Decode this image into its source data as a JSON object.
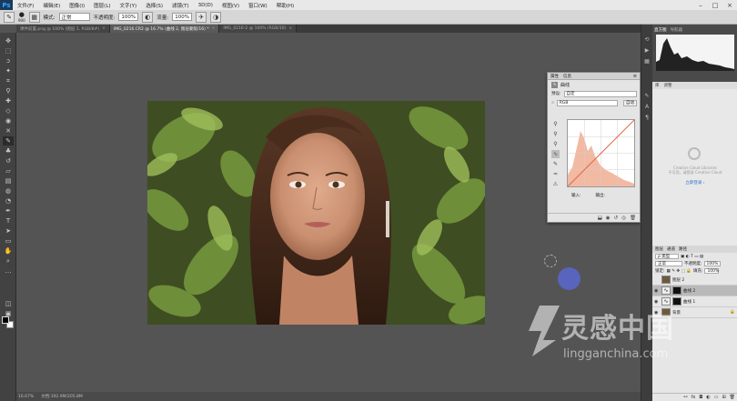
{
  "app": {
    "logo": "Ps"
  },
  "menu": [
    "文件(F)",
    "编辑(E)",
    "图像(I)",
    "图层(L)",
    "文字(Y)",
    "选择(S)",
    "滤镜(T)",
    "3D(D)",
    "视图(V)",
    "窗口(W)",
    "帮助(H)"
  ],
  "window_controls": [
    "–",
    "□",
    "×"
  ],
  "options": {
    "brush_size": "900",
    "mode_label": "模式:",
    "mode_value": "正常",
    "opacity_label": "不透明度:",
    "opacity_value": "100%",
    "flow_label": "流量:",
    "flow_value": "100%"
  },
  "tabs": [
    {
      "title": "课件前置.png @ 100% (图层 1, RGB/8#)",
      "active": false
    },
    {
      "title": "IMG_0216.CR2 @ 16.7% (曲线 2, 图层蒙版/16) *",
      "active": true
    },
    {
      "title": "IMG_0216-2 @ 100% (RGB/16)",
      "active": false
    }
  ],
  "status": {
    "zoom": "16.67%",
    "doc": "文档:192.9M/205.8M"
  },
  "properties": {
    "tabs": [
      "属性",
      "信息"
    ],
    "title": "曲线",
    "preset_label": "预设:",
    "preset_value": "自定",
    "channel_value": "RGB",
    "auto_label": "自动",
    "input_label": "输入:",
    "output_label": "输出:"
  },
  "right": {
    "histogram_tabs": [
      "直方图",
      "导航器"
    ],
    "adjust_tabs": [
      "库",
      "调整"
    ],
    "cc_text": "Creative Cloud Libraries",
    "cc_text2": "不可用，请登录 Creative Cloud",
    "cc_link": "立即登录 ›",
    "layers_tabs": [
      "图层",
      "通道",
      "路径"
    ],
    "kind_label": "ρ 类型",
    "blend_value": "正常",
    "opacity_label": "不透明度:",
    "opacity_value": "100%",
    "lock_label": "锁定:",
    "fill_label": "填充:",
    "fill_value": "100%",
    "layers": [
      {
        "name": "图层 2",
        "type": "pixel",
        "visible": false,
        "selected": false
      },
      {
        "name": "曲线 2",
        "type": "curves",
        "visible": true,
        "selected": true
      },
      {
        "name": "曲线 1",
        "type": "curves",
        "visible": true,
        "selected": false
      },
      {
        "name": "背景",
        "type": "pixel",
        "visible": true,
        "selected": false
      }
    ]
  },
  "watermark": {
    "cn": "灵感中国",
    "en": "lingganchina.com"
  },
  "colors": {
    "blue_dot": "#5a66c8",
    "curve_line": "#e06a4a",
    "histogram_fill": "#f2b9a3"
  }
}
